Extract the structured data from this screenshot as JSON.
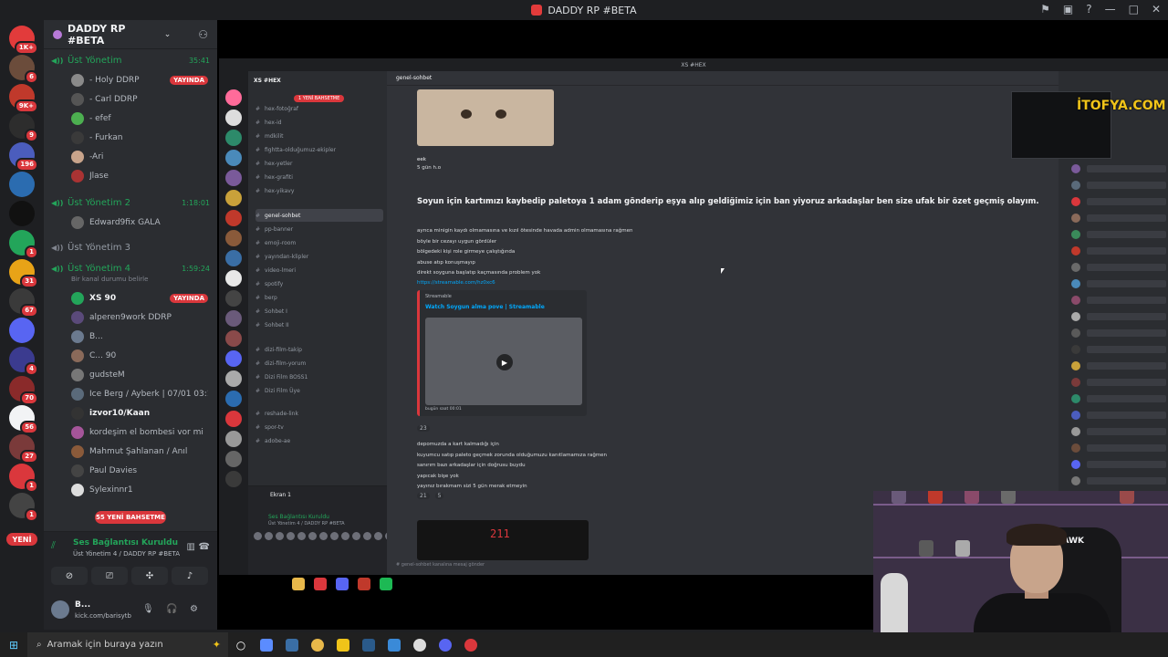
{
  "titlebar": {
    "title": "DADDY RP #BETA"
  },
  "guilds": [
    {
      "badge": "1K+",
      "color": "#e23b3b"
    },
    {
      "badge": "6",
      "color": "#6b4c3b"
    },
    {
      "badge": "9K+",
      "color": "#c0392b"
    },
    {
      "badge": "9",
      "color": "#2d2d2d"
    },
    {
      "badge": "196",
      "color": "#4b5dbd"
    },
    {
      "badge": "",
      "color": "#2b6cb0"
    },
    {
      "badge": "",
      "color": "#111111"
    },
    {
      "badge": "1",
      "color": "#23a55a"
    },
    {
      "badge": "31",
      "color": "#e8a317"
    },
    {
      "badge": "67",
      "color": "#3a3a3a"
    },
    {
      "badge": "",
      "color": "#5865f2"
    },
    {
      "badge": "4",
      "color": "#3b3b8f"
    },
    {
      "badge": "70",
      "color": "#8a2a2a"
    },
    {
      "badge": "56",
      "color": "#f2f3f5"
    },
    {
      "badge": "27",
      "color": "#7a3a3a"
    },
    {
      "badge": "1",
      "color": "#da373c"
    },
    {
      "badge": "1",
      "color": "#444444"
    }
  ],
  "guild_new_label": "YENİ",
  "server": {
    "name": "DADDY RP #BETA"
  },
  "voice_channels": [
    {
      "name": "Üst Yönetim",
      "time": "35:41",
      "active": true
    },
    {
      "name": "Üst Yönetim 2",
      "time": "1:18:01",
      "active": true
    },
    {
      "name": "Üst Yönetim 3",
      "time": "",
      "active": false
    },
    {
      "name": "Üst Yönetim 4",
      "time": "1:59:24",
      "active": true,
      "subtitle": "Bir kanal durumu belirle"
    }
  ],
  "users": [
    {
      "name": "- Holy",
      "tag": "DDRP",
      "live": "YAYINDA",
      "color": "#8a8a8a"
    },
    {
      "name": "- Carl",
      "tag": "DDRP",
      "live": "",
      "color": "#555555"
    },
    {
      "name": "- efef",
      "tag": "",
      "live": "",
      "color": "#4caf50"
    },
    {
      "name": "- Furkan",
      "tag": "",
      "live": "",
      "color": "#3a3a3a"
    },
    {
      "name": "-Ari",
      "tag": "",
      "live": "",
      "color": "#c8a48b"
    },
    {
      "name": "Jlase",
      "tag": "",
      "live": "",
      "color": "#a33"
    },
    {
      "name": "Edward9fix",
      "tag": "GALA",
      "live": "",
      "color": "#666"
    },
    {
      "name": "XS",
      "tag": "90",
      "live": "YAYINDA",
      "color": "#23a55a"
    },
    {
      "name": "alperen9work",
      "tag": "DDRP",
      "live": "",
      "color": "#5a4a7a"
    },
    {
      "name": "B...",
      "tag": "",
      "live": "",
      "color": "#6b7a8f"
    },
    {
      "name": "C...",
      "tag": "90",
      "live": "",
      "color": "#8a6a5a"
    },
    {
      "name": "gudsteM",
      "tag": "",
      "live": "",
      "color": "#777"
    },
    {
      "name": "Ice Berg / Ayberk | 07/01 03:18",
      "tag": "",
      "live": "",
      "color": "#5a6a7a"
    },
    {
      "name": "izvor10/Kaan",
      "tag": "",
      "live": "",
      "color": "#333"
    },
    {
      "name": "kordeşim el bombesi vor mi",
      "tag": "",
      "live": "",
      "color": "#a5559a"
    },
    {
      "name": "Mahmut Şahlanan / Anıl",
      "tag": "",
      "live": "",
      "color": "#8a5a3a"
    },
    {
      "name": "Paul Davies",
      "tag": "",
      "live": "",
      "color": "#444"
    },
    {
      "name": "Sylexinnr1",
      "tag": "",
      "live": "",
      "color": "#ddd"
    }
  ],
  "sidebar_new_banner": "55 YENİ BAHSETME",
  "voice_status": {
    "title": "Ses Bağlantısı Kuruldu",
    "subtitle": "Üst Yönetim 4 / DADDY RP #BETA"
  },
  "user_panel": {
    "name": "B...",
    "status": "kick.com/barisytb"
  },
  "inner": {
    "window_title": "XS #HEX",
    "server_name": "XS #HEX",
    "new_mentions": "1 YENİ BAHSETME",
    "channels": [
      "hex-fotoğraf",
      "hex-id",
      "mdkilit",
      "fightta-olduğumuz-ekipler",
      "hex-yetler",
      "hex-grafiti",
      "hex-yikavy",
      "genel-sohbet",
      "pp-banner",
      "emoji-room",
      "yayından-klipler",
      "video-lmeri",
      "spotify",
      "berp",
      "Sohbet I",
      "Sohbet II",
      "dizi-film-takip",
      "dizi-film-yorum",
      "Dizi Film BOSS1",
      "Dizi Film Üye",
      "reshade-link",
      "spor-tv",
      "adobe-ae"
    ],
    "screen_label": "Ekran 1",
    "screen_status": "Ses Bağlantısı Kuruldu",
    "screen_sub": "Üst Yönetim 4 / DADDY RP #BETA",
    "chat_channel": "genel-sohbet",
    "msg_author_line": "eek",
    "msg_short": "5 gün h.o",
    "msg_bold": "Soyun için kartımızı kaybedip paletoya 1 adam gönderip eşya alıp geldiğimiz için ban yiyoruz arkadaşlar ben size ufak bir özet geçmiş olayım.",
    "msg_lines": [
      "ayrıca minigin kaydı olmamasına ve kızıl ötesinde havada admin olmamasına rağmen",
      "böyle bir cezayı uygun gördüler",
      "bölgedeki kişi role girmeye çalıştığında",
      "abuse atıp konuşmayıp",
      "direkt soyguna başlatıp kaçmasında problem yok"
    ],
    "link": "https://streamable.com/hz0xc6",
    "embed_site": "Streamable",
    "embed_title": "Watch Soygun alma pove | Streamable",
    "embed_footer": "bugün saat 00:01",
    "reaction1": "23",
    "msg_lines2": [
      "depomuzda a kart kalmadığı için",
      "kuyumcu satıp paleto geçmek zorunda olduğumuzu kanıtlamamıza rağmen",
      "sanırım bazı arkadaşlar için doğrusu buydu",
      "yapıcak bişe yok",
      "yayınız bırakmam sizi 5 gün merak etmeyin"
    ],
    "reaction2": "21",
    "reaction3": "5",
    "image_number": "211",
    "chat_placeholder": "# genel-sohbet kanalına mesaj gönder",
    "brand_tag": "İTOFYA.COM"
  },
  "webcam": {
    "chair_text": "HAWK"
  },
  "taskbar": {
    "search_placeholder": "Aramak için buraya yazın"
  }
}
